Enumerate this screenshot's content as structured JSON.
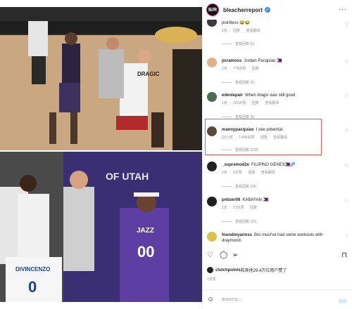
{
  "header": {
    "username": "bleacherreport",
    "avatar_text": "B/R"
  },
  "comments": [
    {
      "username": "",
      "text": "pointless 😂😂",
      "time": "1天",
      "likes": "",
      "reply": "回复",
      "translate": "查看翻译",
      "view_replies": "查看回复 (5)",
      "avatar_color": "#3b3b3b"
    },
    {
      "username": "pcramoss",
      "text": "Jordan Pacquiao 🇵🇭",
      "time": "1天",
      "likes": "778次赞",
      "reply": "回复",
      "translate": "",
      "view_replies": "查看回复 (5)",
      "avatar_color": "#e0b28a"
    },
    {
      "username": "edenlepair",
      "text": "When dragic was still good",
      "time": "1天",
      "likes": "322次赞",
      "reply": "回复",
      "translate": "查看翻译",
      "view_replies": "查看回复 (4)",
      "avatar_color": "#4a6b55"
    },
    {
      "username": "mannypacquiao",
      "text": "I see potential.",
      "time": "23小时",
      "likes": "7,404次赞",
      "reply": "回复",
      "translate": "查看翻译",
      "view_replies": "查看回复 (232)",
      "avatar_color": "#5a4a3a"
    },
    {
      "username": "_supremod2e",
      "text": "FILIPINO GENES🇵🇭🧬",
      "time": "1天",
      "likes": "5次赞",
      "reply": "回复",
      "translate": "查看翻译",
      "view_replies": "查看回复 (24)",
      "avatar_color": "#222222"
    },
    {
      "username": "pnbzer06",
      "text": "KABAYAN 🇵🇭",
      "time": "1天",
      "likes": "15次赞",
      "reply": "回复",
      "translate": "",
      "view_replies": "查看回复 (15)",
      "avatar_color": "#1f1f1f"
    },
    {
      "username": "foundmyarmss",
      "text": "Bro must've had some workouts with draymond.",
      "time": "",
      "likes": "",
      "reply": "",
      "translate": "",
      "view_replies": "",
      "avatar_color": "#d8c24a"
    }
  ],
  "liked_by": {
    "user": "clutchpoints",
    "text": "和其他29.4万位用户赞了"
  },
  "post_date": "1天前",
  "add_comment": {
    "placeholder": "添加评论...",
    "post_label": "发布"
  },
  "icons": {
    "like": "heart-icon",
    "comment": "comment-icon",
    "share": "share-icon",
    "save": "bookmark-icon",
    "emoji": "smile-icon",
    "more": "more-icon"
  },
  "colors": {
    "verified": "#3897f0",
    "highlight": "#e06060",
    "muted": "#8e8e8e"
  },
  "photo_text": {
    "jersey_left": "DIVINCENZO",
    "jersey_left_number": "0",
    "jersey_right_team": "JAZZ",
    "jersey_right_number": "00",
    "court_text": "OF UTAH",
    "top_jersey": "DRAGIC"
  }
}
